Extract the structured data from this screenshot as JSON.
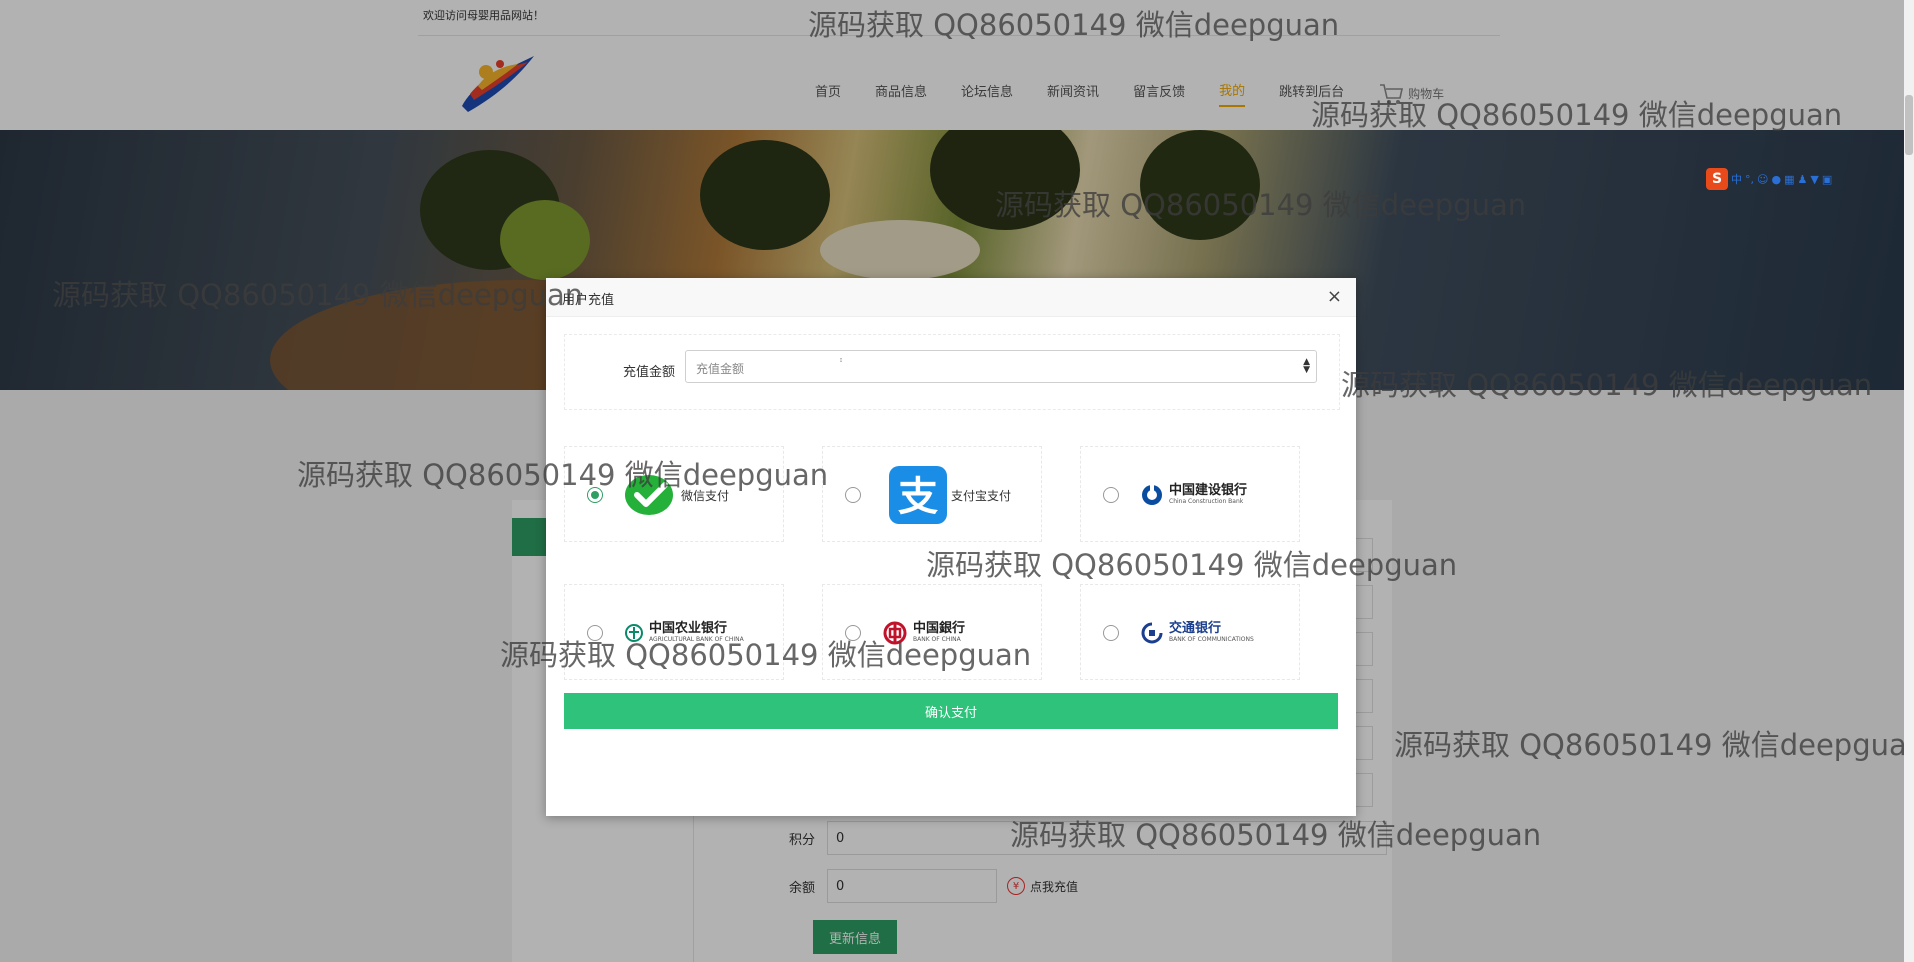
{
  "site": {
    "welcome": "欢迎访问母婴用品网站！",
    "logo_alt": "logo-icon"
  },
  "nav": {
    "items": [
      {
        "label": "首页",
        "active": false
      },
      {
        "label": "商品信息",
        "active": false
      },
      {
        "label": "论坛信息",
        "active": false
      },
      {
        "label": "新闻资讯",
        "active": false
      },
      {
        "label": "留言反馈",
        "active": false
      },
      {
        "label": "我的",
        "active": true
      },
      {
        "label": "跳转到后台",
        "active": false
      }
    ],
    "cart_label": "购物车"
  },
  "profile": {
    "points_label": "积分",
    "points_value": "0",
    "balance_label": "余额",
    "balance_value": "0",
    "recharge_link": "点我充值",
    "update_button": "更新信息"
  },
  "modal": {
    "title": "用户充值",
    "close": "×",
    "amount_label": "充值金额",
    "amount_placeholder": "充值金额",
    "options": [
      {
        "label": "微信支付",
        "checked": true
      },
      {
        "label": "支付宝支付",
        "checked": false
      },
      {
        "label": "中国建设银行",
        "sub": "China Construction Bank",
        "checked": false
      },
      {
        "label": "中国农业银行",
        "sub": "AGRICULTURAL BANK OF CHINA",
        "checked": false
      },
      {
        "label": "中国銀行",
        "sub": "BANK OF CHINA",
        "checked": false
      },
      {
        "label": "交通银行",
        "sub": "BANK OF COMMUNICATIONS",
        "checked": false
      }
    ],
    "confirm_button": "确认支付"
  },
  "ime": {
    "logo": "S",
    "mode": "中"
  },
  "watermark": "源码获取 QQ86050149 微信deepguan",
  "colors": {
    "accent_green": "#2ec27a",
    "nav_active": "#f2a900",
    "alipay_blue": "#1a8ee6",
    "wechat_green": "#25b03a"
  }
}
